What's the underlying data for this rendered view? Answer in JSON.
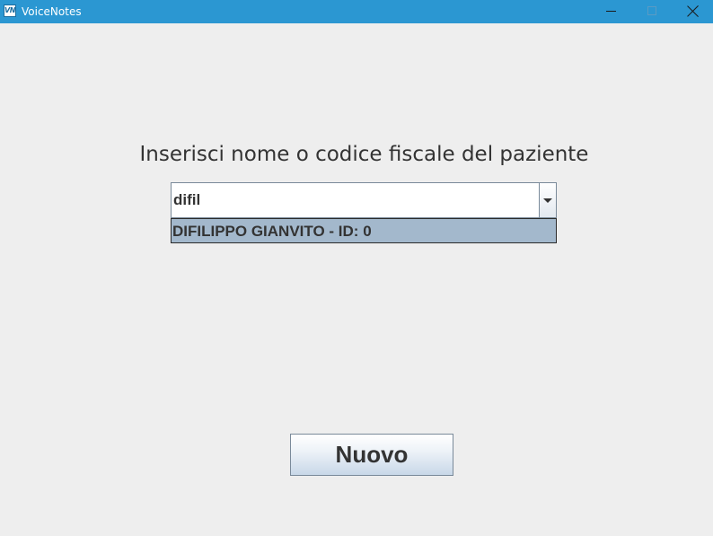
{
  "window": {
    "title": "VoiceNotes",
    "icon_text": "VN",
    "controls": [
      "minimize",
      "maximize",
      "close"
    ]
  },
  "main": {
    "prompt": "Inserisci nome o codice fiscale del paziente",
    "search": {
      "value": "difil"
    },
    "suggestions": [
      "DIFILIPPO GIANVITO - ID: 0"
    ],
    "new_button_label": "Nuovo"
  },
  "colors": {
    "titlebar": "#2b97d2",
    "background": "#eeeeee",
    "selection": "#a3b8cc",
    "text": "#333333"
  },
  "icons": {
    "app": "voicenotes-app-icon",
    "minimize": "minimize-icon",
    "maximize": "maximize-icon",
    "close": "close-icon",
    "dropdown": "chevron-down-icon"
  }
}
